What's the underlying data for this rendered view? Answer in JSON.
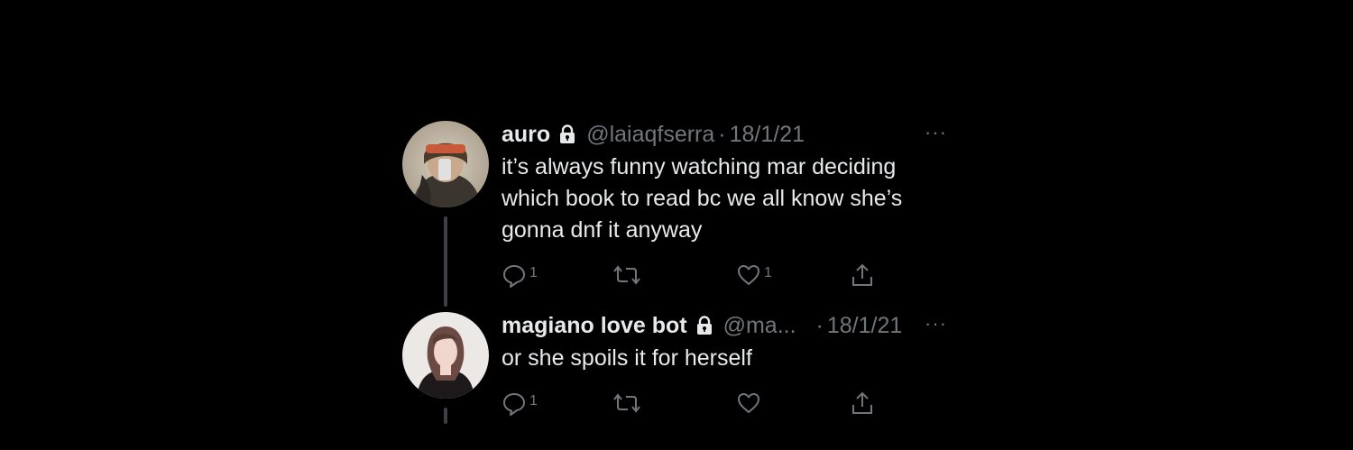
{
  "tweets": [
    {
      "name": "auro",
      "handle": "@laiaqfserra",
      "separator": "·",
      "date": "18/1/21",
      "more": "···",
      "lines": [
        "it’s always funny watching mar deciding",
        "which book to read bc we all know she’s",
        "gonna dnf it anyway"
      ],
      "reply_count": "1",
      "retweet_count": "",
      "like_count": "1",
      "avatar_icon": "avatar-photo",
      "protected_icon": "lock-icon"
    },
    {
      "name": "magiano love bot",
      "handle": "@ma...",
      "separator": "·",
      "date": "18/1/21",
      "more": "···",
      "lines": [
        "or she spoils it for herself"
      ],
      "reply_count": "1",
      "retweet_count": "",
      "like_count": "",
      "avatar_icon": "avatar-photo",
      "protected_icon": "lock-icon"
    }
  ],
  "colors": {
    "background": "#000000",
    "primary_text": "#e7e9ea",
    "secondary_text": "#71767b",
    "thread_line": "#3d4144"
  }
}
